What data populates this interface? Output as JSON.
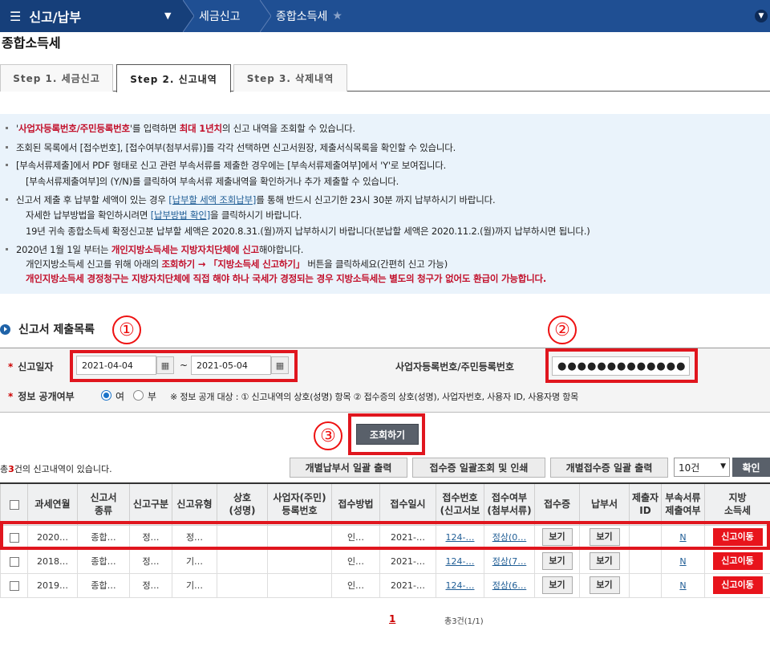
{
  "topbar": {
    "menu_label": "신고/납부",
    "breadcrumb": [
      "세금신고",
      "종합소득세"
    ]
  },
  "page_title": "종합소득세",
  "tabs": [
    "Step 1. 세금신고",
    "Step 2. 신고내역",
    "Step 3. 삭제내역"
  ],
  "active_tab": 1,
  "notice": {
    "l1_a": "'",
    "l1_b": "사업자등록번호/주민등록번호",
    "l1_c": "'를 입력하면 ",
    "l1_d": "최대 1년치",
    "l1_e": "의 신고 내역을 조회할 수 있습니다.",
    "l2": "조회된 목록에서 [접수번호], [접수여부(첨부서류)]를 각각 선택하면 신고서원장, 제출서식목록을 확인할 수 있습니다.",
    "l3": "[부속서류제출]에서 PDF 형태로 신고 관련 부속서류를 제출한 경우에는 [부속서류제출여부]에서 'Y'로 보여집니다.",
    "l4": "[부속서류제출여부]의 (Y/N)를 클릭하여 부속서류 제출내역을 확인하거나 추가 제출할 수 있습니다.",
    "l5_a": "신고서 제출 후 납부할 세액이 있는 경우 ",
    "l5_b": "[납부할 세액 조회납부]",
    "l5_c": "를 통해 반드시 신고기한 23시 30분 까지 납부하시기 바랍니다.",
    "l6_a": "자세한 납부방법을 확인하시려면 ",
    "l6_b": "[납부방법 확인]",
    "l6_c": "을 클릭하시기 바랍니다.",
    "l7": "19년 귀속 종합소득세 확정신고분 납부할 세액은 2020.8.31.(월)까지 납부하시기 바랍니다(분납할 세액은 2020.11.2.(월)까지 납부하시면 됩니다.)",
    "l8_a": "2020년 1월 1일 부터는 ",
    "l8_b": "개인지방소득세는 지방자치단체에 신고",
    "l8_c": "해야합니다.",
    "l9_a": "개인지방소득세 신고를 위해 아래의 ",
    "l9_b": "조회하기 → 「지방소득세 신고하기」",
    "l9_c": " 버튼을 클릭하세요(간편히 신고 가능)",
    "l10": "개인지방소득세 경정청구는 지방자치단체에 직접 해야 하나 국세가 경정되는 경우 지방소득세는 별도의 청구가 없어도 환급이 가능합니다."
  },
  "section_title": "신고서 제출목록",
  "annotations": [
    "①",
    "②",
    "③"
  ],
  "search": {
    "date_label": "신고일자",
    "date_from": "2021-04-04",
    "date_to": "2021-05-04",
    "tilde": "~",
    "id_label": "사업자등록번호/주민등록번호",
    "id_value": "●●●●●●●●●●●●●",
    "public_label": "정보 공개여부",
    "opt_yes": "여",
    "opt_no": "부",
    "public_note": "※ 정보 공개 대상 : ① 신고내역의 상호(성명) 항목 ② 접수증의 상호(성명), 사업자번호, 사용자 ID, 사용자명 항목",
    "search_button": "조회하기"
  },
  "toolbar": {
    "total_pre": "총",
    "total_count": "3",
    "total_post": "건의 신고내역이 있습니다.",
    "btn_payment": "개별납부서 일괄 출력",
    "btn_receipt": "접수증 일괄조회 및 인쇄",
    "btn_indiv": "개별접수증 일괄 출력",
    "page_size": "10건",
    "confirm": "확인"
  },
  "table": {
    "headers": [
      "",
      "과세연월",
      "신고서\n종류",
      "신고구분",
      "신고유형",
      "상호\n(성명)",
      "사업자(주민)\n등록번호",
      "접수방법",
      "접수일시",
      "접수번호\n(신고서보",
      "접수여부\n(첨부서류)",
      "접수증",
      "납부서",
      "제출자\nID",
      "부속서류\n제출여부",
      "지방\n소득세"
    ],
    "rows": [
      {
        "year": "2020…",
        "type": "종합…",
        "div": "정…",
        "kind": "정…",
        "name": "",
        "reg": "",
        "method": "인…",
        "date": "2021-…",
        "no": "124-…",
        "status": "정상(0…",
        "receipt": "보기",
        "pay": "보기",
        "submitter": "",
        "attach": "N",
        "local": "신고이동"
      },
      {
        "year": "2018…",
        "type": "종합…",
        "div": "정…",
        "kind": "기…",
        "name": "",
        "reg": "",
        "method": "인…",
        "date": "2021-…",
        "no": "124-…",
        "status": "정상(7…",
        "receipt": "보기",
        "pay": "보기",
        "submitter": "",
        "attach": "N",
        "local": "신고이동"
      },
      {
        "year": "2019…",
        "type": "종합…",
        "div": "정…",
        "kind": "기…",
        "name": "",
        "reg": "",
        "method": "인…",
        "date": "2021-…",
        "no": "124-…",
        "status": "정상(6…",
        "receipt": "보기",
        "pay": "보기",
        "submitter": "",
        "attach": "N",
        "local": "신고이동"
      }
    ]
  },
  "pager": {
    "current": "1",
    "info": "총3건(1/1)"
  },
  "colors": {
    "topbar": "#1f4f93",
    "accent_red": "#e0161e",
    "notice_bg": "#eaf3fb"
  }
}
